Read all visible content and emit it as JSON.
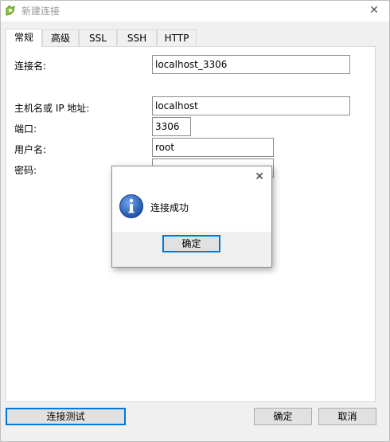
{
  "window": {
    "title": "新建连接",
    "close_symbol": "✕",
    "icon": "navicat-app-icon"
  },
  "tabs": [
    {
      "label": "常规",
      "active": true
    },
    {
      "label": "高级",
      "active": false
    },
    {
      "label": "SSL",
      "active": false
    },
    {
      "label": "SSH",
      "active": false
    },
    {
      "label": "HTTP",
      "active": false
    }
  ],
  "form": {
    "connection_name_label": "连接名:",
    "connection_name_value": "localhost_3306",
    "host_label": "主机名或 IP 地址:",
    "host_value": "localhost",
    "port_label": "端口:",
    "port_value": "3306",
    "username_label": "用户名:",
    "username_value": "root",
    "password_label": "密码:",
    "password_value": "••••••"
  },
  "buttons": {
    "test_label": "连接测试",
    "ok_label": "确定",
    "cancel_label": "取消"
  },
  "dialog": {
    "message": "连接成功",
    "ok_label": "确定",
    "close_symbol": "✕",
    "icon": "info-icon"
  },
  "colors": {
    "accent": "#0078d7",
    "info_blue": "#1d5bb8"
  }
}
